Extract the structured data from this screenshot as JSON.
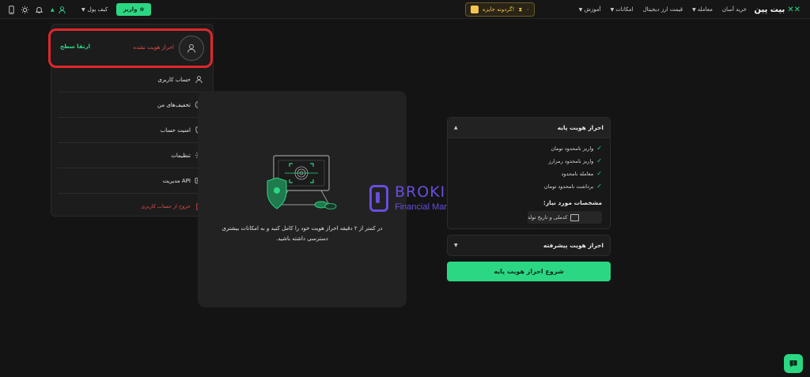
{
  "topbar": {
    "logo_text": "بیت پین",
    "menu": [
      {
        "label": "خرید آسان",
        "caret": false
      },
      {
        "label": "معامله",
        "caret": true
      },
      {
        "label": "قیمت ارز دیجیتال",
        "caret": false
      },
      {
        "label": "امکانات",
        "caret": true
      },
      {
        "label": "آموزش",
        "caret": true
      }
    ],
    "reward_label": "گردونه جایزه!",
    "reward_count": "۰",
    "deposit_label": "واریز",
    "wallet_label": "کیف پول"
  },
  "dropdown": {
    "status": "احراز هویت نشده",
    "upgrade": "ارتقا سطح",
    "items": [
      {
        "label": "حساب کاربری",
        "icon": "user-icon"
      },
      {
        "label": "تخفیف‌های من",
        "icon": "discount-icon"
      },
      {
        "label": "امنیت حساب",
        "icon": "shield-icon"
      },
      {
        "label": "تنظیمات",
        "icon": "gear-icon"
      },
      {
        "label": "مدیریت API",
        "icon": "api-icon"
      }
    ],
    "logout": "خروج از حساب کاربری"
  },
  "center": {
    "text": "در کمتر از ۲ دقیقه احراز هویت خود را کامل کنید و به امکانات بیشتری دسترسی داشته باشید."
  },
  "watermark": {
    "title": "BROKIFY",
    "subtitle": "Financial Markets"
  },
  "basic": {
    "title": "احراز هویت پایه",
    "features": [
      "واریز نامحدود تومان",
      "واریز نامحدود رمزارز",
      "معامله نامحدود",
      "برداشت نامحدود تومان"
    ],
    "requirements_title": "مشخصات مورد نیاز:",
    "requirement": "کدملی و تاریخ تولد"
  },
  "advanced": {
    "title": "احراز هویت پیشرفته"
  },
  "start_button": "شروع احراز هویت پایه",
  "colors": {
    "accent": "#2bd783",
    "background": "#141414",
    "danger": "#e24c4c",
    "highlight_border": "#e0272b",
    "watermark": "#6a4de0"
  }
}
